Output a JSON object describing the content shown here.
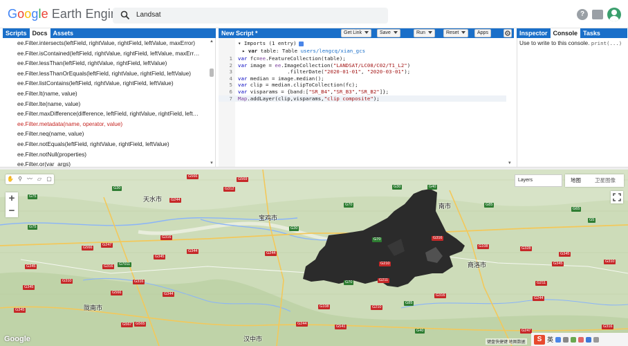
{
  "header": {
    "logo": {
      "google": "Google",
      "earth_engine": "Earth Engine"
    },
    "search_value": "Landsat",
    "icons": [
      "help-icon",
      "feedback-icon",
      "avatar"
    ]
  },
  "left_panel": {
    "tabs": [
      {
        "label": "Scripts"
      },
      {
        "label": "Docs"
      },
      {
        "label": "Assets"
      }
    ],
    "active_tab": "Docs",
    "doc_items": [
      {
        "text": "ee.Filter.intersects(leftField, rightValue, rightField, leftValue, maxError)",
        "color": "#222222"
      },
      {
        "text": "ee.Filter.isContained(leftField, rightValue, rightField, leftValue, maxErr…",
        "color": "#222222"
      },
      {
        "text": "ee.Filter.lessThan(leftField, rightValue, rightField, leftValue)",
        "color": "#222222"
      },
      {
        "text": "ee.Filter.lessThanOrEquals(leftField, rightValue, rightField, leftValue)",
        "color": "#222222"
      },
      {
        "text": "ee.Filter.listContains(leftField, rightValue, rightField, leftValue)",
        "color": "#222222"
      },
      {
        "text": "ee.Filter.lt(name, value)",
        "color": "#222222"
      },
      {
        "text": "ee.Filter.lte(name, value)",
        "color": "#222222"
      },
      {
        "text": "ee.Filter.maxDifference(difference, leftField, rightValue, rightField, left…",
        "color": "#222222"
      },
      {
        "text": "ee.Filter.metadata(name, operator, value)",
        "color": "#c5221f"
      },
      {
        "text": "ee.Filter.neq(name, value)",
        "color": "#222222"
      },
      {
        "text": "ee.Filter.notEquals(leftField, rightValue, rightField, leftValue)",
        "color": "#222222"
      },
      {
        "text": "ee.Filter.notNull(properties)",
        "color": "#222222"
      },
      {
        "text": "ee.Filter.or(var_args)",
        "color": "#222222"
      }
    ]
  },
  "editor": {
    "title": "New Script *",
    "buttons": {
      "get_link": "Get Link",
      "save": "Save",
      "run": "Run",
      "reset": "Reset",
      "apps": "Apps"
    },
    "imports_header": "Imports (1 entry)",
    "import_var": {
      "keyword": "var",
      "name": "table",
      "type": "Table",
      "path": "users/lengcq/xian_gcs"
    },
    "lines": [
      {
        "n": "1",
        "code": "var fc=ee.FeatureCollection(table);"
      },
      {
        "n": "2",
        "code": "var image = ee.ImageCollection(\"LANDSAT/LC08/C02/T1_L2\")"
      },
      {
        "n": "3",
        "code": "                .filterDate(\"2020-01-01\", \"2020-03-01\");"
      },
      {
        "n": "4",
        "code": "var median = image.median();"
      },
      {
        "n": "5",
        "code": "var clip = median.clipToCollection(fc);"
      },
      {
        "n": "6",
        "code": "var visparams = {band:[\"SR_B4\",\"SR_B3\",\"SR_B2\"]};"
      },
      {
        "n": "7",
        "code": "Map.addLayer(clip,visparams,\"clip composite\");"
      }
    ]
  },
  "right_panel": {
    "tabs": [
      {
        "label": "Inspector"
      },
      {
        "label": "Console"
      },
      {
        "label": "Tasks"
      }
    ],
    "active_tab": "Console",
    "console_message": "Use to write to this console.",
    "console_code": "print(...)"
  },
  "map": {
    "layers_label": "Layers",
    "map_types": [
      "地图",
      "卫星图像"
    ],
    "zoom_in": "+",
    "zoom_out": "−",
    "google_logo": "Google",
    "attribution": "键盘快捷键   地图数据",
    "tray": {
      "s_logo": "S",
      "ime": "英"
    },
    "cities": [
      {
        "name": "天水市"
      },
      {
        "name": "宝鸡市"
      },
      {
        "name": "南市"
      },
      {
        "name": "商洛市"
      },
      {
        "name": "陇南市"
      },
      {
        "name": "汉中市"
      }
    ],
    "roads_green": [
      "G30",
      "G75",
      "G70",
      "G30",
      "G70",
      "G40",
      "G30",
      "G7011",
      "G85",
      "G65",
      "G5",
      "G70",
      "G85",
      "G40",
      "G75"
    ],
    "roads_red": [
      "G566",
      "G569",
      "G244",
      "G312",
      "G345",
      "G247",
      "G316",
      "G344",
      "G310",
      "G566",
      "G345",
      "G566",
      "G316",
      "G344",
      "G211",
      "G210",
      "G108",
      "G316",
      "G328",
      "G211",
      "G345",
      "G244",
      "G345",
      "G310",
      "G345",
      "G316",
      "G565",
      "G567",
      "G244",
      "G345",
      "G108",
      "G541",
      "G244",
      "G210",
      "G316",
      "G247",
      "G316"
    ],
    "colors": {
      "land": "#c9d9b7",
      "raster": "#2b2b2b",
      "river": "#8ab4f8"
    }
  }
}
